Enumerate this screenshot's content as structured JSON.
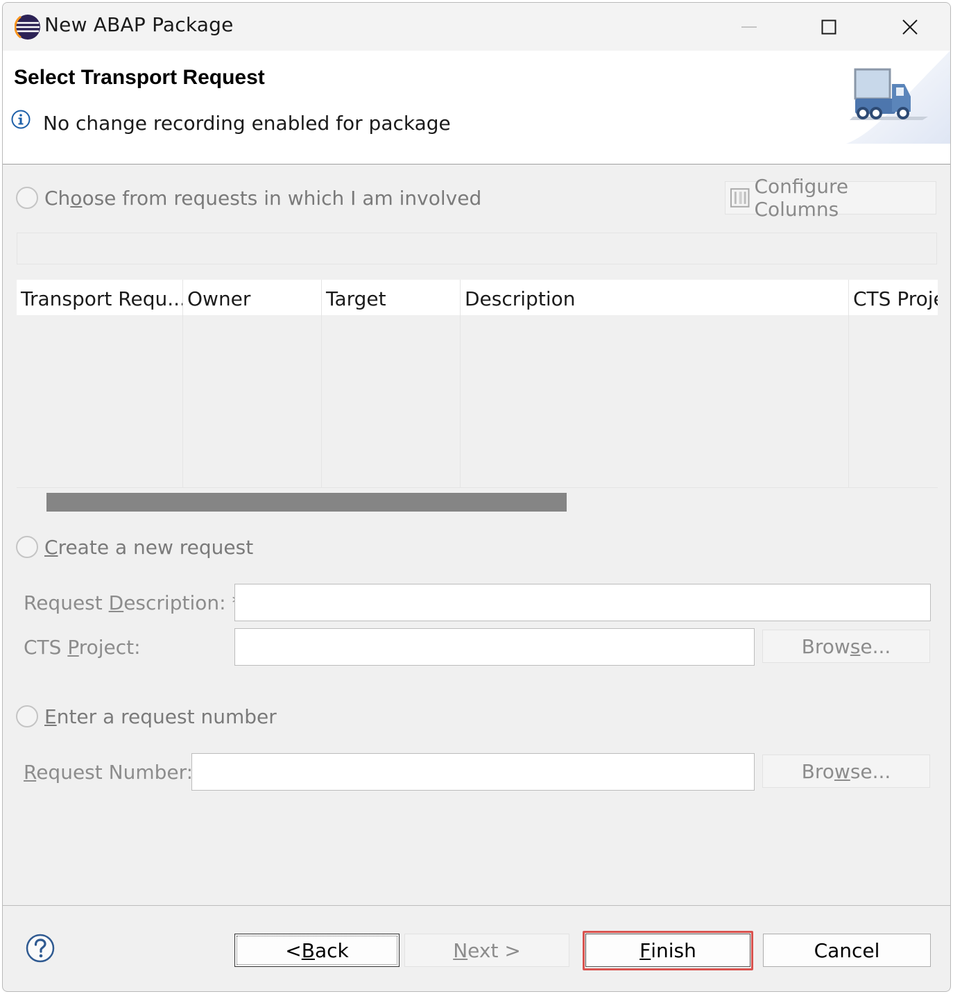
{
  "window": {
    "title": "New ABAP Package"
  },
  "header": {
    "title": "Select Transport Request",
    "message": "No change recording enabled for package"
  },
  "choose_section": {
    "radio_label_pre": "Ch",
    "radio_label_u": "o",
    "radio_label_post": "ose from requests in which I am involved",
    "configure_columns": "Configure Columns",
    "columns": [
      "Transport Requ...",
      "Owner",
      "Target",
      "Description",
      "CTS Proje"
    ]
  },
  "create_section": {
    "radio_label_u": "C",
    "radio_label_post": "reate a new request",
    "desc_label_pre": "Request ",
    "desc_label_u": "D",
    "desc_label_post": "escription: *",
    "project_label_pre": "CTS ",
    "project_label_u": "P",
    "project_label_post": "roject:",
    "desc_value": "",
    "project_value": "",
    "browse_pre": "Brow",
    "browse_u": "s",
    "browse_post": "e..."
  },
  "enter_section": {
    "radio_label_u": "E",
    "radio_label_post": "nter a request number",
    "number_label_u": "R",
    "number_label_post": "equest Number:",
    "number_value": "",
    "browse_pre": "Bro",
    "browse_u": "w",
    "browse_post": "se..."
  },
  "footer": {
    "back_pre": "< ",
    "back_u": "B",
    "back_post": "ack",
    "next_u": "N",
    "next_post": "ext >",
    "finish_u": "F",
    "finish_post": "inish",
    "cancel": "Cancel"
  }
}
